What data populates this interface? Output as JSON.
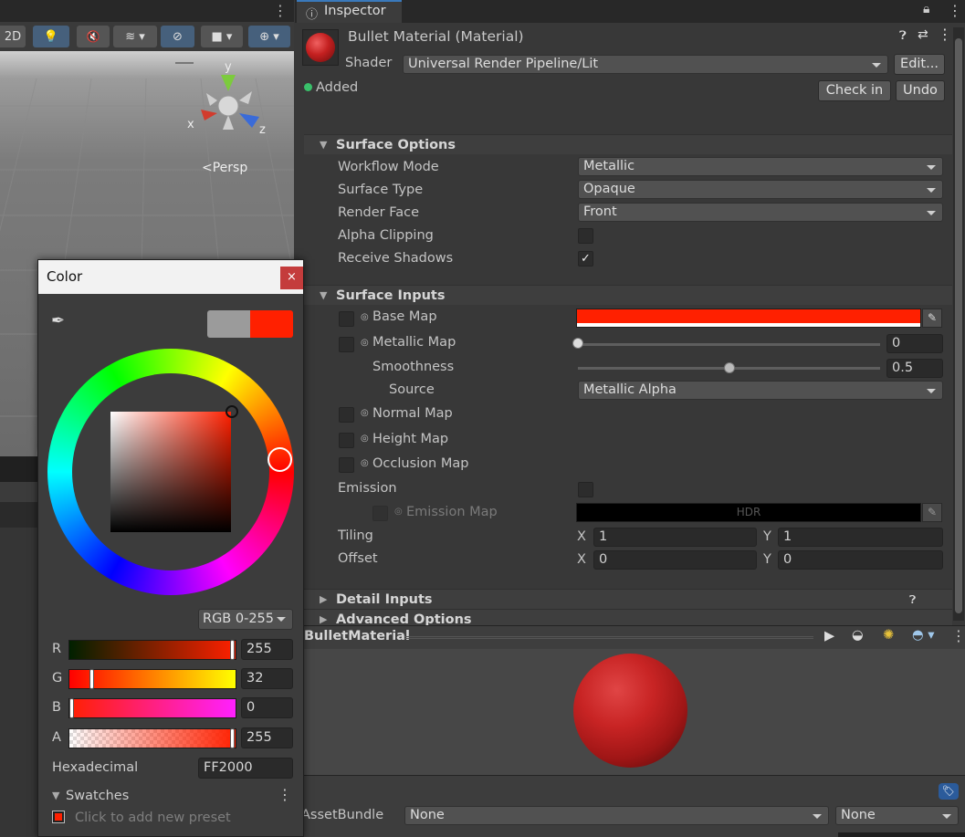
{
  "scene": {
    "toolbar": {
      "mode_2d": "2D"
    },
    "gizmo": {
      "y_label": "y",
      "x_label": "x",
      "z_label": "z",
      "projection_label": "Persp"
    }
  },
  "inspector": {
    "tab_label": "Inspector",
    "material_title": "Bullet Material (Material)",
    "shader_label": "Shader",
    "shader_value": "Universal Render Pipeline/Lit",
    "edit_button": "Edit...",
    "added_label": "Added",
    "check_in_button": "Check in",
    "undo_button": "Undo",
    "surface_options": {
      "header": "Surface Options",
      "rows": [
        {
          "label": "Workflow Mode",
          "value": "Metallic"
        },
        {
          "label": "Surface Type",
          "value": "Opaque"
        },
        {
          "label": "Render Face",
          "value": "Front"
        }
      ],
      "alpha_clipping_label": "Alpha Clipping",
      "alpha_clipping": false,
      "receive_shadows_label": "Receive Shadows",
      "receive_shadows": true
    },
    "surface_inputs": {
      "header": "Surface Inputs",
      "base_map_label": "Base Map",
      "base_color": "#ff2000",
      "metallic_map_label": "Metallic Map",
      "metallic_value": "0",
      "metallic_fraction": 0,
      "smoothness_label": "Smoothness",
      "smoothness_value": "0.5",
      "smoothness_fraction": 0.5,
      "source_label": "Source",
      "source_value": "Metallic Alpha",
      "normal_map_label": "Normal Map",
      "height_map_label": "Height Map",
      "occlusion_map_label": "Occlusion Map",
      "emission_label": "Emission",
      "emission_enabled": false,
      "emission_map_label": "Emission Map",
      "emission_hdr_label": "HDR",
      "tiling_label": "Tiling",
      "offset_label": "Offset",
      "x_label": "X",
      "y_label": "Y",
      "tiling_x": "1",
      "tiling_y": "1",
      "offset_x": "0",
      "offset_y": "0"
    },
    "detail_inputs_header": "Detail Inputs",
    "advanced_options_header": "Advanced Options"
  },
  "preview": {
    "title": "BulletMaterial"
  },
  "asset_bundle": {
    "label": "AssetBundle",
    "name_value": "None",
    "variant_value": "None"
  },
  "color_picker": {
    "title": "Color",
    "close_glyph": "×",
    "mode": "RGB 0-255",
    "channels": [
      {
        "label": "R",
        "value": "255",
        "fraction": 1.0
      },
      {
        "label": "G",
        "value": "32",
        "fraction": 0.125
      },
      {
        "label": "B",
        "value": "0",
        "fraction": 0.0
      },
      {
        "label": "A",
        "value": "255",
        "fraction": 1.0
      }
    ],
    "hex_label": "Hexadecimal",
    "hex_value": "FF2000",
    "previous_color": "#9b9b9b",
    "current_color": "#ff2000",
    "swatches_label": "Swatches",
    "add_preset_text": "Click to add new preset"
  }
}
